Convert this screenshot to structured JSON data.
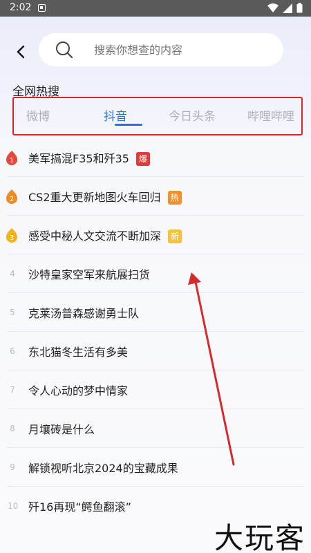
{
  "status_bar": {
    "time": "2:02"
  },
  "search": {
    "placeholder": "搜索你想查的内容"
  },
  "section_title": "全网热搜",
  "tabs": [
    {
      "label": "微博",
      "active": false
    },
    {
      "label": "抖音",
      "active": true
    },
    {
      "label": "今日头条",
      "active": false
    },
    {
      "label": "哔哩哔哩",
      "active": false
    }
  ],
  "colors": {
    "accent": "#2a6fdb",
    "rank1": "#e6473b",
    "rank2": "#f08a24",
    "rank3": "#f2b21c",
    "tag_bao": "#e23a3a",
    "tag_re": "#f0922c",
    "tag_xin": "#f5c23a",
    "highlight_box": "#e02424"
  },
  "list": [
    {
      "rank": "1",
      "text": "美军搞混F35和歼35",
      "tag": "爆"
    },
    {
      "rank": "2",
      "text": "CS2重大更新地图火车回归",
      "tag": "热"
    },
    {
      "rank": "3",
      "text": "感受中秘人文交流不断加深",
      "tag": "新"
    },
    {
      "rank": "4",
      "text": "沙特皇家空军来航展扫货",
      "tag": ""
    },
    {
      "rank": "5",
      "text": "克莱汤普森感谢勇士队",
      "tag": ""
    },
    {
      "rank": "6",
      "text": "东北猫冬生活有多美",
      "tag": ""
    },
    {
      "rank": "7",
      "text": "令人心动的梦中情家",
      "tag": ""
    },
    {
      "rank": "8",
      "text": "月壤砖是什么",
      "tag": ""
    },
    {
      "rank": "9",
      "text": "解锁视听北京2024的宝藏成果",
      "tag": ""
    },
    {
      "rank": "10",
      "text": "歼16再现“鳄鱼翻滚”",
      "tag": ""
    }
  ],
  "watermark": "大玩客"
}
